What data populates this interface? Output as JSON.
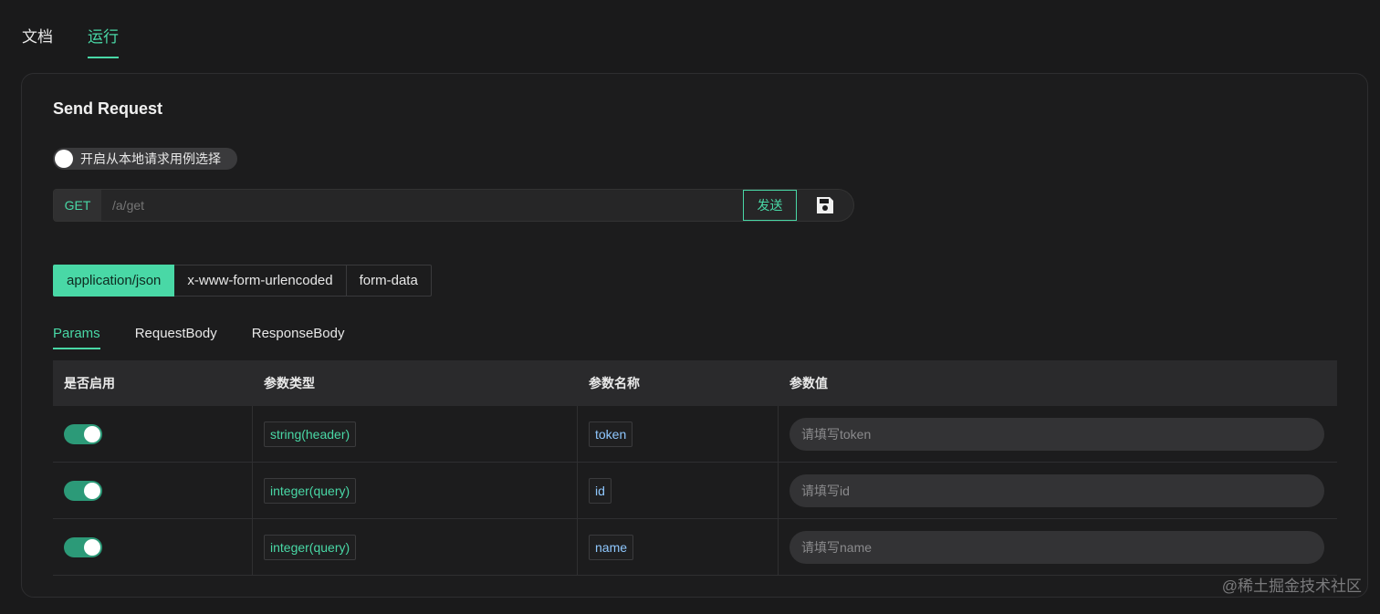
{
  "top_tabs": [
    {
      "label": "文档",
      "active": false
    },
    {
      "label": "运行",
      "active": true
    }
  ],
  "card": {
    "title": "Send Request",
    "local_toggle_label": "开启从本地请求用例选择",
    "local_toggle_on": false
  },
  "request": {
    "method": "GET",
    "url_placeholder": "/a/get",
    "send_label": "发送",
    "save_icon": "save-icon"
  },
  "content_types": [
    {
      "label": "application/json",
      "active": true
    },
    {
      "label": "x-www-form-urlencoded",
      "active": false
    },
    {
      "label": "form-data",
      "active": false
    }
  ],
  "sub_tabs": [
    {
      "label": "Params",
      "active": true
    },
    {
      "label": "RequestBody",
      "active": false
    },
    {
      "label": "ResponseBody",
      "active": false
    }
  ],
  "table": {
    "headers": [
      "是否启用",
      "参数类型",
      "参数名称",
      "参数值"
    ],
    "rows": [
      {
        "enabled": true,
        "type": "string(header)",
        "name": "token",
        "placeholder": "请填写token"
      },
      {
        "enabled": true,
        "type": "integer(query)",
        "name": "id",
        "placeholder": "请填写id"
      },
      {
        "enabled": true,
        "type": "integer(query)",
        "name": "name",
        "placeholder": "请填写name"
      }
    ]
  },
  "watermark": "@稀土掘金技术社区",
  "colors": {
    "accent": "#49d8a6",
    "background": "#1a1a1b",
    "switch_on": "#2c9a78"
  }
}
